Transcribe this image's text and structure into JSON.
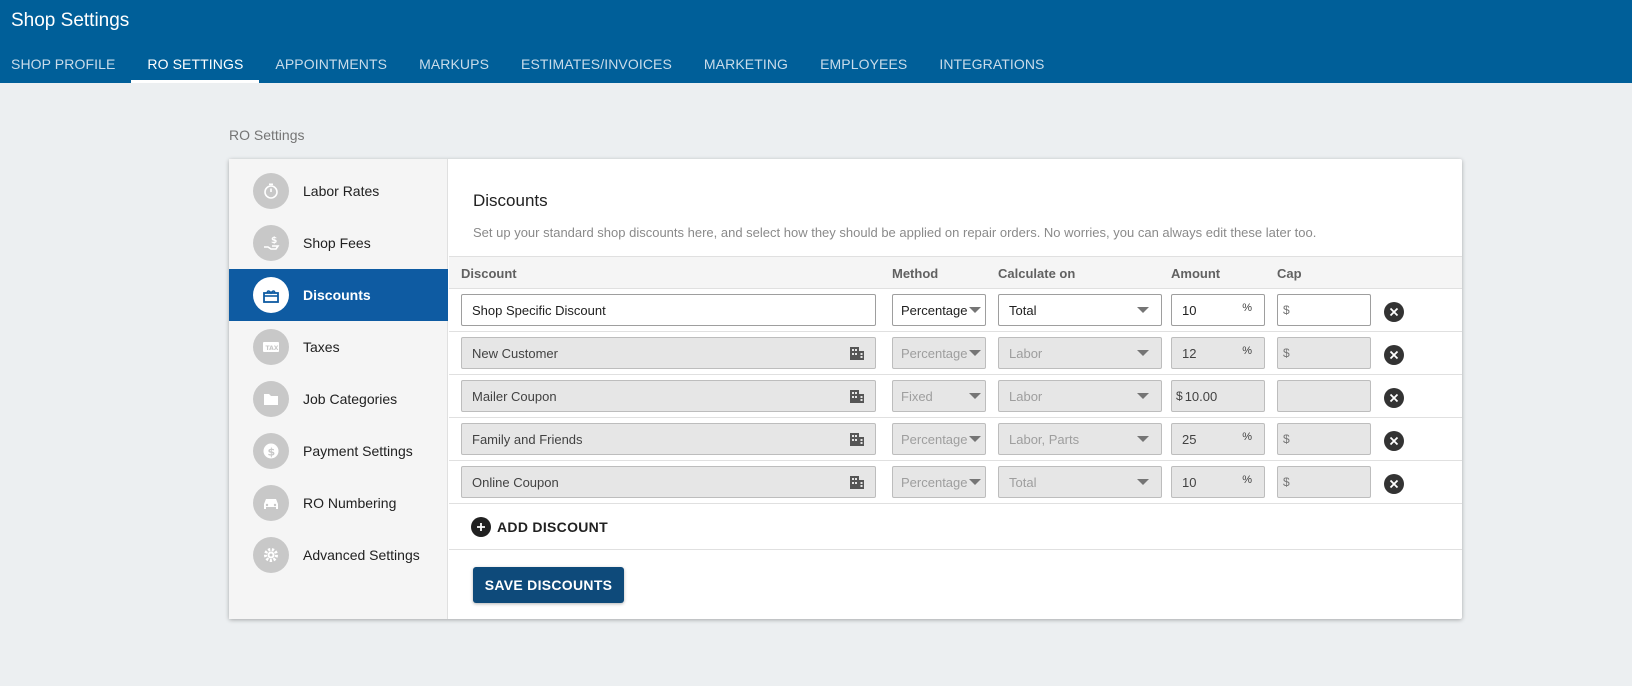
{
  "header": {
    "title": "Shop Settings",
    "tabs": [
      "SHOP PROFILE",
      "RO SETTINGS",
      "APPOINTMENTS",
      "MARKUPS",
      "ESTIMATES/INVOICES",
      "MARKETING",
      "EMPLOYEES",
      "INTEGRATIONS"
    ],
    "active_tab": "RO SETTINGS"
  },
  "breadcrumb": "RO Settings",
  "sidebar": {
    "items": [
      {
        "label": "Labor Rates",
        "icon": "stopwatch-icon"
      },
      {
        "label": "Shop Fees",
        "icon": "hand-coin-icon"
      },
      {
        "label": "Discounts",
        "icon": "gift-icon"
      },
      {
        "label": "Taxes",
        "icon": "tax-icon"
      },
      {
        "label": "Job Categories",
        "icon": "folder-icon"
      },
      {
        "label": "Payment Settings",
        "icon": "dollar-icon"
      },
      {
        "label": "RO Numbering",
        "icon": "car-icon"
      },
      {
        "label": "Advanced Settings",
        "icon": "gear-icon"
      }
    ],
    "active": "Discounts"
  },
  "section": {
    "title": "Discounts",
    "description": "Set up your standard shop discounts here, and select how they should be applied on repair orders. No worries, you can always edit these later too."
  },
  "table": {
    "headers": {
      "discount": "Discount",
      "method": "Method",
      "calculate_on": "Calculate on",
      "amount": "Amount",
      "cap": "Cap"
    },
    "rows": [
      {
        "name": "Shop Specific Discount",
        "method": "Percentage",
        "calculate_on": "Total",
        "amount": "10",
        "amount_suffix": "%",
        "cap_prefix": "$",
        "editable": true
      },
      {
        "name": "New Customer",
        "method": "Percentage",
        "calculate_on": "Labor",
        "amount": "12",
        "amount_suffix": "%",
        "cap_prefix": "$",
        "editable": false
      },
      {
        "name": "Mailer Coupon",
        "method": "Fixed",
        "calculate_on": "Labor",
        "amount": "10.00",
        "amount_prefix": "$",
        "cap_prefix": "",
        "editable": false
      },
      {
        "name": "Family and Friends",
        "method": "Percentage",
        "calculate_on": "Labor, Parts",
        "amount": "25",
        "amount_suffix": "%",
        "cap_prefix": "$",
        "editable": false
      },
      {
        "name": "Online Coupon",
        "method": "Percentage",
        "calculate_on": "Total",
        "amount": "10",
        "amount_suffix": "%",
        "cap_prefix": "$",
        "editable": false
      }
    ]
  },
  "actions": {
    "add_label": "ADD DISCOUNT",
    "save_label": "SAVE DISCOUNTS"
  },
  "colors": {
    "header_bg": "#005f99",
    "active_side": "#0e5ba2",
    "save_button": "#0e4a7a",
    "page_bg": "#eceff1"
  }
}
